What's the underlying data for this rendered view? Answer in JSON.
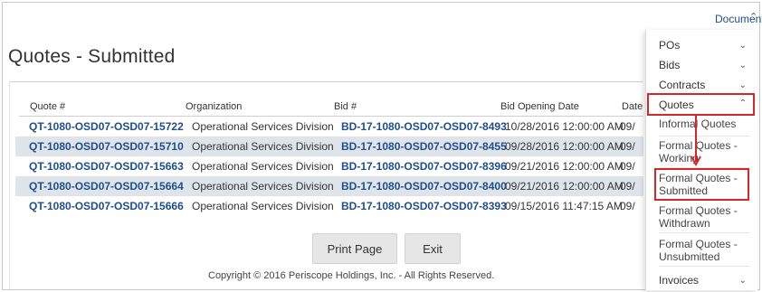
{
  "page": {
    "title": "Quotes - Submitted"
  },
  "table": {
    "headers": [
      "Quote #",
      "Organization",
      "Bid #",
      "Bid Opening Date",
      "Date"
    ],
    "rows": [
      {
        "quote": "QT-1080-OSD07-OSD07-15722",
        "org": "Operational Services Division",
        "bid": "BD-17-1080-OSD07-OSD07-8493",
        "opening": "10/28/2016 12:00:00 AM",
        "date": "09/"
      },
      {
        "quote": "QT-1080-OSD07-OSD07-15710",
        "org": "Operational Services Division",
        "bid": "BD-17-1080-OSD07-OSD07-8455",
        "opening": "09/28/2016 12:00:00 AM",
        "date": "09/"
      },
      {
        "quote": "QT-1080-OSD07-OSD07-15663",
        "org": "Operational Services Division",
        "bid": "BD-17-1080-OSD07-OSD07-8396",
        "opening": "09/21/2016 12:00:00 AM",
        "date": "09/"
      },
      {
        "quote": "QT-1080-OSD07-OSD07-15664",
        "org": "Operational Services Division",
        "bid": "BD-17-1080-OSD07-OSD07-8400",
        "opening": "09/21/2016 12:00:00 AM",
        "date": "09/"
      },
      {
        "quote": "QT-1080-OSD07-OSD07-15666",
        "org": "Operational Services Division",
        "bid": "BD-17-1080-OSD07-OSD07-8393",
        "opening": "09/15/2016 11:47:15 AM",
        "date": "09/"
      }
    ]
  },
  "buttons": {
    "print": "Print Page",
    "exit": "Exit"
  },
  "footer": {
    "copyright": "Copyright © 2016 Periscope Holdings, Inc. - All Rights Reserved."
  },
  "documents_menu": {
    "title": "Documents",
    "items": [
      {
        "label": "POs"
      },
      {
        "label": "Bids"
      },
      {
        "label": "Contracts"
      },
      {
        "label": "Quotes"
      },
      {
        "label": "Invoices"
      }
    ],
    "quotes_submenu": [
      "Informal Quotes",
      "Formal Quotes - Working",
      "Formal Quotes - Submitted",
      "Formal Quotes - Withdrawn",
      "Formal Quotes - Unsubmitted"
    ]
  },
  "colors": {
    "link": "#1f4e8c",
    "highlight": "#d7262b",
    "alt_row": "#dfe4eb"
  },
  "icons": {
    "chevron_down": "chevron-down-icon",
    "chevron_up": "chevron-up-icon",
    "arrow": "red-arrow-down"
  }
}
